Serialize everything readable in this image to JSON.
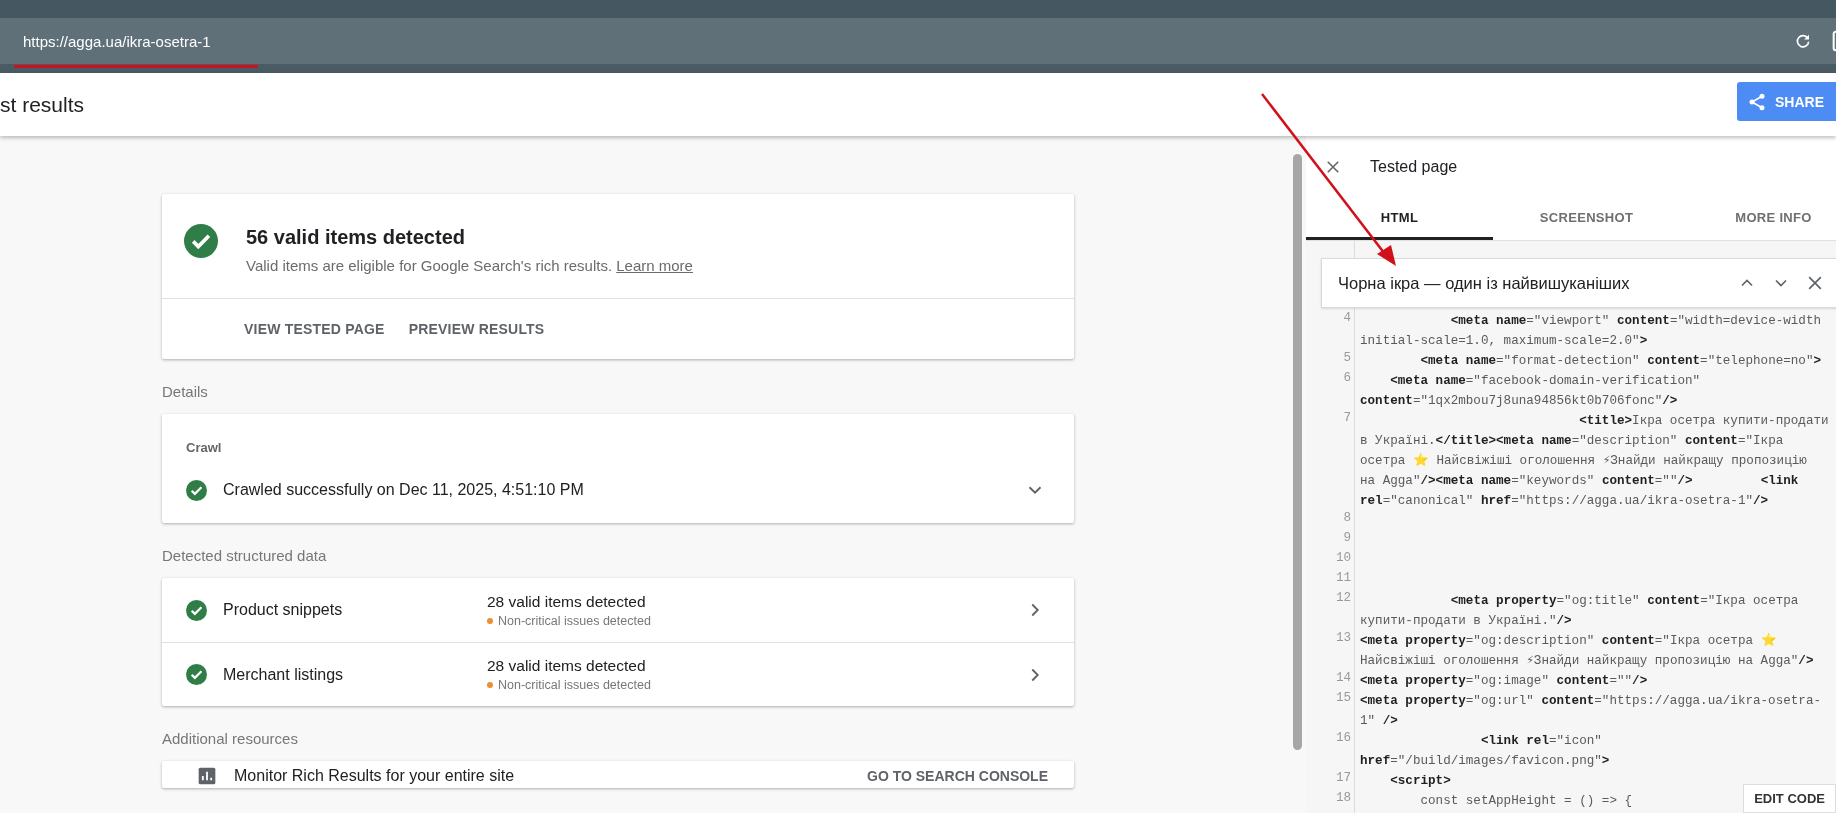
{
  "browser": {
    "url": "https://agga.ua/ikra-osetra-1"
  },
  "header": {
    "title": "st results",
    "share_button": "SHARE"
  },
  "summary": {
    "title": "56 valid items detected",
    "description": "Valid items are eligible for Google Search's rich results.",
    "link": "Learn more",
    "actions": [
      "VIEW TESTED PAGE",
      "PREVIEW RESULTS"
    ]
  },
  "details": {
    "heading": "Details",
    "section": "Crawl",
    "status": "Crawled successfully on Dec 11, 2025, 4:51:10 PM",
    "expanded": false
  },
  "structured_data": {
    "heading": "Detected structured data",
    "items": [
      {
        "name": "Product snippets",
        "count": "28 valid items detected",
        "note": "Non-critical issues detected"
      },
      {
        "name": "Merchant listings",
        "count": "28 valid items detected",
        "note": "Non-critical issues detected"
      }
    ]
  },
  "additional": {
    "heading": "Additional resources",
    "items": [
      {
        "text": "Monitor Rich Results for your entire site",
        "action": "GO TO SEARCH CONSOLE"
      }
    ]
  },
  "panel": {
    "title": "Tested page",
    "tabs": [
      {
        "label": "HTML",
        "selected": true
      },
      {
        "label": "SCREENSHOT",
        "selected": false
      },
      {
        "label": "MORE INFO",
        "selected": false
      }
    ],
    "search": {
      "value": "Чорна ікра — один із найвишуканіших"
    },
    "code_lines": [
      {
        "number": "4",
        "rows": [
          "            **<meta name**=\"viewport\" **content**=\"width=device-width",
          "initial-scale=1.0, maximum-scale=2.0\"**>**"
        ]
      },
      {
        "number": "5",
        "rows": [
          "        **<meta name**=\"format-detection\" **content**=\"telephone=no\"**>**"
        ]
      },
      {
        "number": "6",
        "rows": [
          "    **<meta name**=\"facebook-domain-verification\"",
          "**content**=\"1qx2mbou7j8una94856kt0b706fonc\"**/>**"
        ]
      },
      {
        "number": "7",
        "rows": [
          "                             **<title>**Ікра осетра купити-продати",
          "в Україні.**</title><meta name**=\"description\" **content**=\"Ікра",
          "осетра ⭐ Найсвіжіші оголошення ⚡Знайди найкращу пропозицію",
          "на Agga\"**/><meta name**=\"keywords\" **content**=\"\"**/>**         **<link**",
          "**rel**=\"canonical\" **href**=\"https://agga.ua/ikra-osetra-1\"**/>**"
        ]
      },
      {
        "number": "8"
      },
      {
        "number": "9"
      },
      {
        "number": "10"
      },
      {
        "number": "11"
      },
      {
        "number": "12",
        "rows": [
          "            **<meta property**=\"og:title\" **content**=\"Ікра осетра",
          "купити-продати в Україні.\"**/>**"
        ]
      },
      {
        "number": "13",
        "rows": [
          "**<meta property**=\"og:description\" **content**=\"Ікра осетра ⭐",
          "Найсвіжіші оголошення ⚡Знайди найкращу пропозицію на Agga\"**/>**"
        ]
      },
      {
        "number": "14",
        "rows": [
          "**<meta property**=\"og:image\" **content**=\"\"**/>**"
        ]
      },
      {
        "number": "15",
        "rows": [
          "**<meta property**=\"og:url\" **content**=\"https://agga.ua/ikra-osetra-",
          "1\" **/>**"
        ]
      },
      {
        "number": "16",
        "rows": [
          "                **<link rel**=\"icon\"",
          "**href**=\"/build/images/favicon.png\"**>**"
        ]
      },
      {
        "number": "17",
        "rows": [
          "    **<script>**"
        ]
      },
      {
        "number": "18",
        "rows": [
          "        const setAppHeight = () => {"
        ]
      }
    ],
    "edit_button": "EDIT CODE"
  }
}
